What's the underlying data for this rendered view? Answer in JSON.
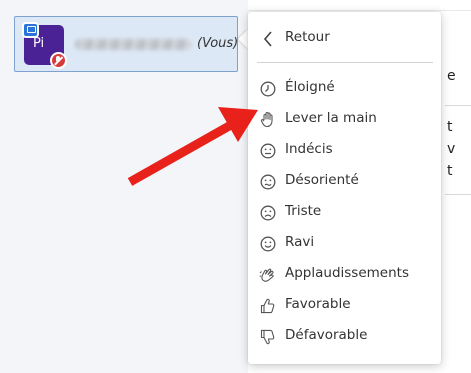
{
  "user_list": {
    "current_user": {
      "initials": "Pi",
      "name_redacted": true,
      "you_label": "(Vous)",
      "avatar_color": "#4a2296",
      "presenter_badge_color": "#2a75d8",
      "mic_muted_badge_color": "#d63b3b"
    }
  },
  "status_menu": {
    "back_label": "Retour",
    "items": [
      {
        "label": "Éloigné",
        "icon": "away-clock-icon"
      },
      {
        "label": "Lever la main",
        "icon": "raise-hand-icon"
      },
      {
        "label": "Indécis",
        "icon": "neutral-face-icon"
      },
      {
        "label": "Désorienté",
        "icon": "confused-face-icon"
      },
      {
        "label": "Triste",
        "icon": "sad-face-icon"
      },
      {
        "label": "Ravi",
        "icon": "happy-face-icon"
      },
      {
        "label": "Applaudissements",
        "icon": "applause-icon"
      },
      {
        "label": "Favorable",
        "icon": "thumbs-up-icon"
      },
      {
        "label": "Défavorable",
        "icon": "thumbs-down-icon"
      }
    ]
  },
  "background_chat_fragments": [
    "e",
    "t",
    "v",
    "t"
  ],
  "annotation": {
    "arrow_color": "#e8221b",
    "points_to": "Lever la main"
  }
}
